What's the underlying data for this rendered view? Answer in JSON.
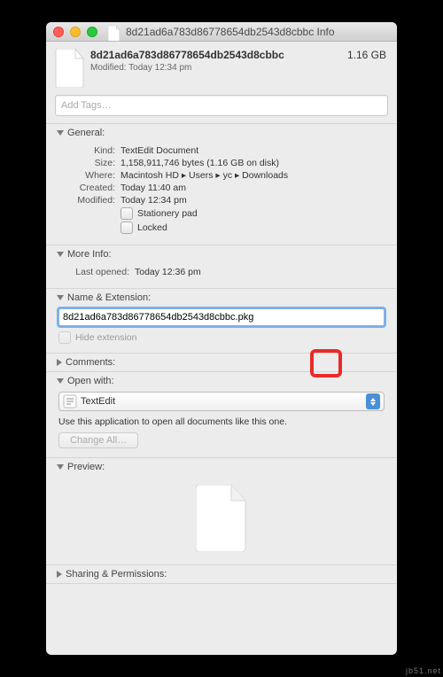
{
  "window": {
    "title": "8d21ad6a783d86778654db2543d8cbbc Info"
  },
  "header": {
    "filename": "8d21ad6a783d86778654db2543d8cbbc",
    "modified": "Modified: Today 12:34 pm",
    "size": "1.16 GB"
  },
  "tags": {
    "placeholder": "Add Tags…"
  },
  "sections": {
    "general": "General:",
    "more_info": "More Info:",
    "name_ext": "Name & Extension:",
    "comments": "Comments:",
    "open_with": "Open with:",
    "preview": "Preview:",
    "sharing": "Sharing & Permissions:"
  },
  "general": {
    "kind_l": "Kind:",
    "kind_v": "TextEdit Document",
    "size_l": "Size:",
    "size_v": "1,158,911,746 bytes (1.16 GB on disk)",
    "where_l": "Where:",
    "where_v": "Macintosh HD ▸ Users ▸ yc ▸ Downloads",
    "created_l": "Created:",
    "created_v": "Today 11:40 am",
    "modified_l": "Modified:",
    "modified_v": "Today 12:34 pm",
    "stationery": "Stationery pad",
    "locked": "Locked"
  },
  "more_info": {
    "last_l": "Last opened:",
    "last_v": "Today 12:36 pm"
  },
  "name_ext": {
    "value": "8d21ad6a783d86778654db2543d8cbbc.pkg",
    "hide": "Hide extension"
  },
  "open_with": {
    "app": "TextEdit",
    "desc": "Use this application to open all documents like this one.",
    "change_all": "Change All…"
  }
}
